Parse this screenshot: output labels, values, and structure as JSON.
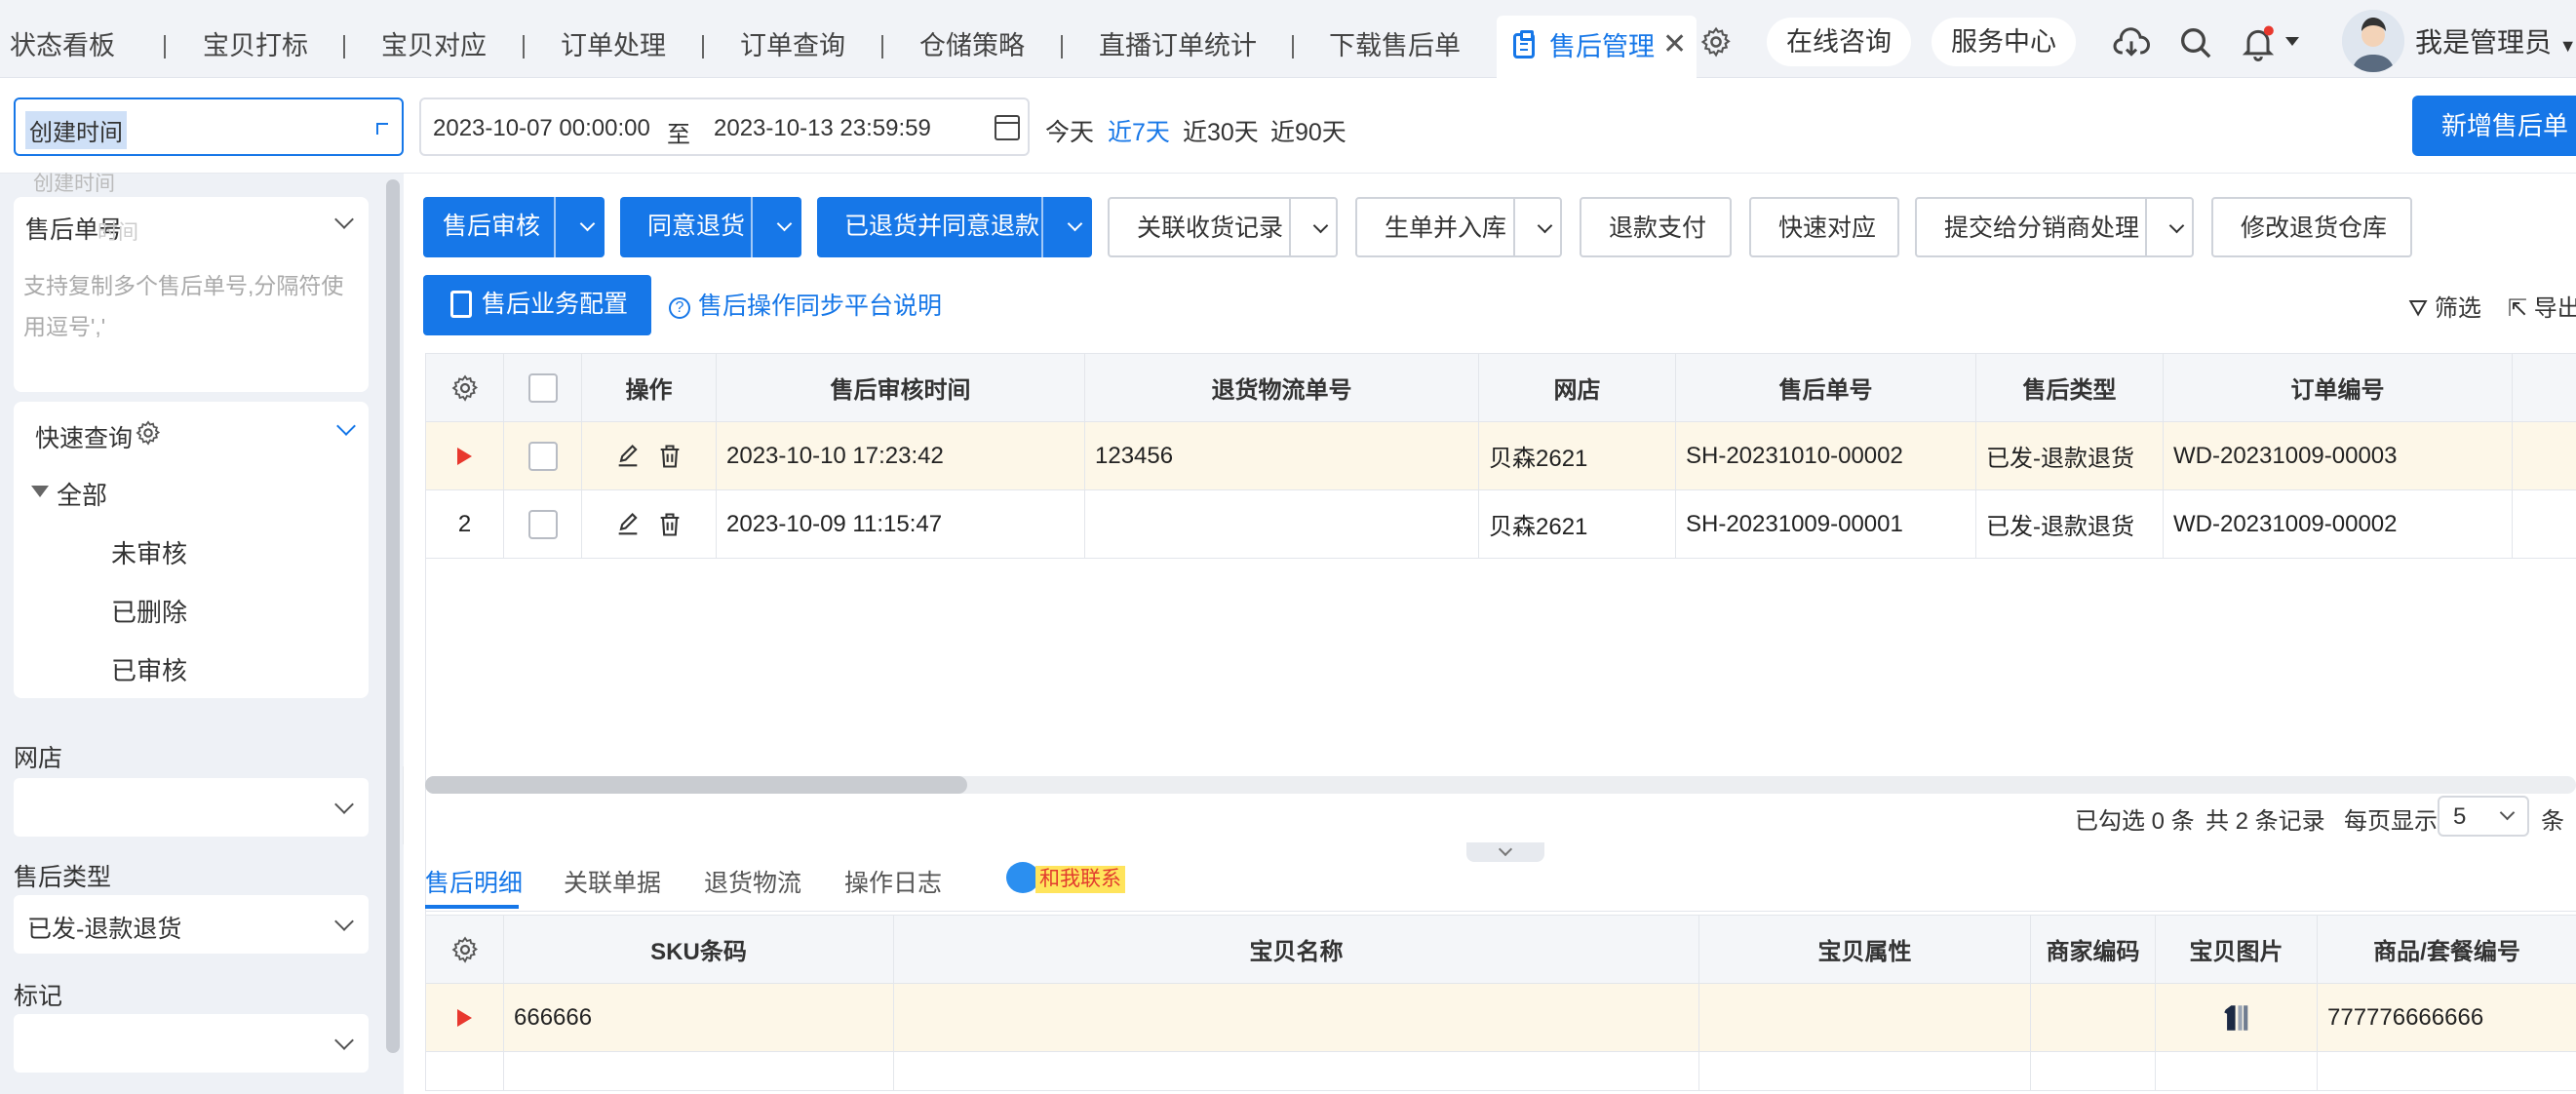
{
  "top_tabs": [
    "状态看板",
    "宝贝打标",
    "宝贝对应",
    "订单处理",
    "订单查询",
    "仓储策略",
    "直播订单统计",
    "下载售后单"
  ],
  "active_tab": "售后管理",
  "header": {
    "online_consult": "在线咨询",
    "service_center": "服务中心",
    "user_name": "我是管理员"
  },
  "filter": {
    "time_type": "创建时间",
    "date_start": "2023-10-07 00:00:00",
    "date_sep": "至",
    "date_end": "2023-10-13 23:59:59",
    "quick": [
      "今天",
      "近7天",
      "近30天",
      "近90天"
    ],
    "quick_active": "近7天",
    "new_button": "新增售后单"
  },
  "sidebar": {
    "ghost_option_1": "创建时间",
    "ghost_option_2": "时间",
    "order_no_title": "售后单号",
    "order_no_placeholder": "支持复制多个售后单号,分隔符使用逗号','",
    "quick_query_title": "快速查询",
    "tree_root": "全部",
    "tree_items": [
      "未审核",
      "已删除",
      "已审核"
    ],
    "shop_label": "网店",
    "shop_value": "",
    "type_label": "售后类型",
    "type_value": "已发-退款退货",
    "mark_label": "标记",
    "mark_value": ""
  },
  "toolbar": {
    "audit": "售后审核",
    "agree_return": "同意退货",
    "returned_refund": "已退货并同意退款",
    "link_receipt": "关联收货记录",
    "gen_inbound": "生单并入库",
    "refund_pay": "退款支付",
    "express_match": "快速对应",
    "submit_distributor": "提交给分销商处理",
    "modify_warehouse": "修改退货仓库",
    "biz_config": "售后业务配置",
    "help": "售后操作同步平台说明",
    "filter": "筛选",
    "export": "导出"
  },
  "main_table": {
    "columns": [
      "操作",
      "售后审核时间",
      "退货物流单号",
      "网店",
      "售后单号",
      "售后类型",
      "订单编号"
    ],
    "rows": [
      {
        "index": "",
        "audit_time": "2023-10-10 17:23:42",
        "logistics": "123456",
        "shop": "贝森2621",
        "after_no": "SH-20231010-00002",
        "type": "已发-退款退货",
        "order_no": "WD-20231009-00003"
      },
      {
        "index": "2",
        "audit_time": "2023-10-09 11:15:47",
        "logistics": "",
        "shop": "贝森2621",
        "after_no": "SH-20231009-00001",
        "type": "已发-退款退货",
        "order_no": "WD-20231009-00002"
      }
    ]
  },
  "pager": {
    "selected": "已勾选 0 条",
    "total": "共 2 条记录",
    "per_page_label": "每页显示",
    "per_page": "5",
    "unit": "条"
  },
  "bottom_tabs": [
    "售后明细",
    "关联单据",
    "退货物流",
    "操作日志"
  ],
  "contact": "和我联系",
  "detail_table": {
    "columns": [
      "SKU条码",
      "宝贝名称",
      "宝贝属性",
      "商家编码",
      "宝贝图片",
      "商品/套餐编号"
    ],
    "rows": [
      {
        "sku": "666666",
        "name": "",
        "attr": "",
        "merchant_code": "",
        "product_no": "777776666666"
      }
    ]
  },
  "colors": {
    "primary": "#1677e8",
    "highlight_row": "#fdf7e8",
    "marker": "#e8382e"
  }
}
